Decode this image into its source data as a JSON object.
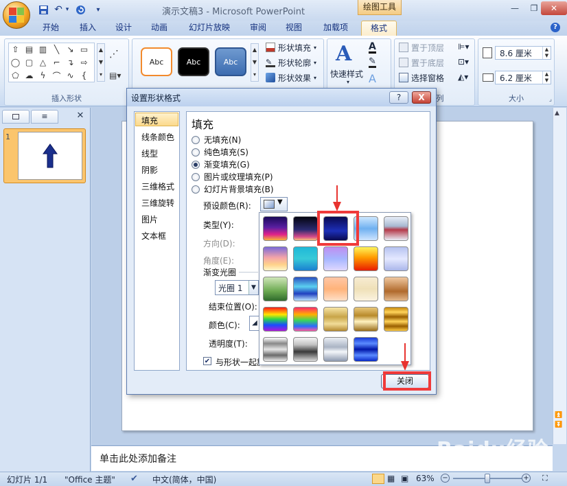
{
  "window": {
    "title": "演示文稿3 - Microsoft PowerPoint",
    "context_tab_group": "绘图工具"
  },
  "tabs": [
    "开始",
    "插入",
    "设计",
    "动画",
    "幻灯片放映",
    "审阅",
    "视图",
    "加载项",
    "格式"
  ],
  "ribbon": {
    "insert_shapes_label": "插入形状",
    "style_sample_text": "Abc",
    "shape_fill": "形状填充",
    "shape_outline": "形状轮廓",
    "shape_effects": "形状效果",
    "quick_styles": "快速样式",
    "bring_front": "置于顶层",
    "send_back": "置于底层",
    "selection_pane": "选择窗格",
    "arrange_partial": "列",
    "height_value": "8.6 厘米",
    "width_value": "6.2 厘米",
    "size_label": "大小"
  },
  "left_panel": {
    "slide_number": "1"
  },
  "dialog": {
    "title": "设置形状格式",
    "help_label": "?",
    "close_x": "X",
    "nav_items": [
      "填充",
      "线条颜色",
      "线型",
      "阴影",
      "三维格式",
      "三维旋转",
      "图片",
      "文本框"
    ],
    "selected_nav": "填充",
    "heading": "填充",
    "fill_options": [
      {
        "label": "无填充(N)",
        "checked": false
      },
      {
        "label": "纯色填充(S)",
        "checked": false
      },
      {
        "label": "渐变填充(G)",
        "checked": true
      },
      {
        "label": "图片或纹理填充(P)",
        "checked": false
      },
      {
        "label": "幻灯片背景填充(B)",
        "checked": false
      }
    ],
    "preset_colors_label": "预设颜色(R):",
    "type_label": "类型(Y):",
    "direction_label": "方向(D):",
    "angle_label": "角度(E):",
    "gradient_stops_label": "渐变光圈",
    "stop_value": "光圈 1",
    "end_position_label": "结束位置(O):",
    "color_label": "颜色(C):",
    "transparency_label": "透明度(T):",
    "rotate_with_shape_label": "与形状一起旋转",
    "rotate_checked": true,
    "close_button": "关闭"
  },
  "notes_placeholder": "单击此处添加备注",
  "status": {
    "slide_info": "幻灯片 1/1",
    "theme": "\"Office 主题\"",
    "language": "中文(简体，中国)",
    "zoom": "63%"
  },
  "watermark": {
    "main": "Baidu经验",
    "sub": "jingyan.baidu.com"
  },
  "colors": {
    "highlight_red": "#f03a3a",
    "thumb_arrow": "#1a2f8c",
    "accent_orange": "#f3a521"
  },
  "palette_gradients": [
    [
      "linear-gradient(#1b0a5a,#5a1fa1 45%,#e0208a 75%,#f7b23a)",
      "linear-gradient(#050510,#2a2a70 55%,#d54a8a 85%,#f6c27a)",
      "linear-gradient(#0a0a50,#1d2fb8 60%,#0a0a50)",
      "linear-gradient(#cde7ff,#6fb0f0 50%,#cfe5ff)",
      "linear-gradient(#e8eef8,#a7b7d0 40%,#b43a4a 55%,#e9eef8)"
    ],
    [
      "linear-gradient(#7a6ad8,#f4a4a8 45%,#ffd38a 75%,#fff6cc)",
      "linear-gradient(#1fb8d8,#37c9d8 50%,#1a7fd0)",
      "linear-gradient(#c08ef0,#a6b6ff 50%,#e0d8ff)",
      "linear-gradient(#fff45a,#ff9a00 45%,#e81c00)",
      "linear-gradient(#b6c2f0,#e4e8ff 50%,#aab6ea)"
    ],
    [
      "linear-gradient(#cfe6b8,#6aa84f 60%,#2f6b2c)",
      "linear-gradient(#2a4fbf,#5bd0f0 40%,#2040c0 70%,#bde4ff)",
      "linear-gradient(#ffc7a6,#ffb37a 50%,#ffe0c8)",
      "linear-gradient(#f7ecd2,#efe0b8 50%,#fbf3e0)",
      "linear-gradient(#f0c8a0,#b06a2c 60%,#e4b88c)"
    ],
    [
      "linear-gradient(#ff1a1a,#ffe600 30%,#2ad64a 50%,#1a4bff 75%,#b01ad6)",
      "linear-gradient(#ff2a6a,#ffb000 30%,#3ad65a 55%,#2a6aff 80%,#ff5aa0)",
      "linear-gradient(#f7e5a6,#c8a548 40%,#f1dc98 70%,#b48a30)",
      "linear-gradient(#e8c77a,#b88a2a 35%,#fff2c0 60%,#9a6e1a)",
      "linear-gradient(#c88a10,#ffd35a 20%,#9a5f00 40%,#ffd35a 60%,#9a5f00 80%,#ffcc44)"
    ],
    [
      "linear-gradient(#ffffff,#888 25%,#e6e6e6 50%,#6a6a6a 75%,#f0f0f0)",
      "linear-gradient(#f4f4f4,#c2c2c2 30%,#3a3a3a 60%,#dcdcdc)",
      "linear-gradient(#eaeef4,#aab4c4 40%,#f4f6fa 60%,#8e9ab0)",
      "linear-gradient(#1a3bd6,#5a8aff 25%,#0016a8 50%,#5a8aff 75%,#0a2ac8)"
    ]
  ]
}
